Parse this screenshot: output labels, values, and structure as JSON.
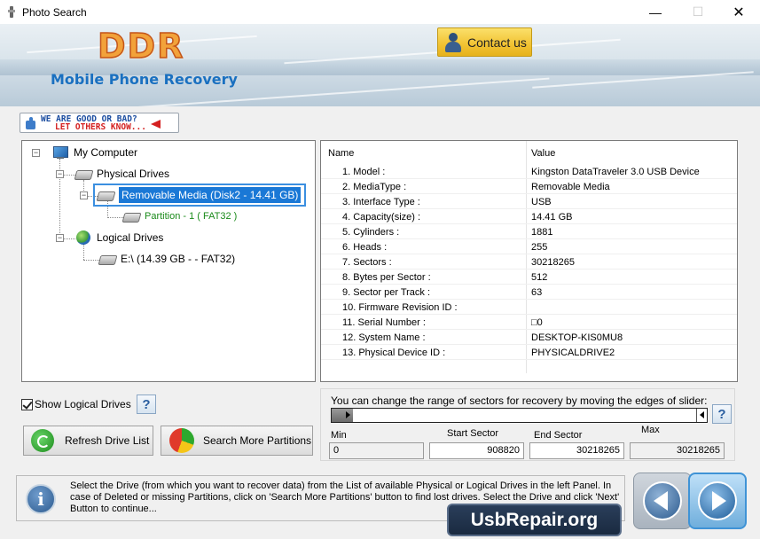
{
  "window": {
    "title": "Photo Search",
    "controls": {
      "minimize": "—",
      "maximize": "☐",
      "close": "✕"
    }
  },
  "header": {
    "logo": "DDR",
    "subtitle": "Mobile Phone Recovery",
    "contact_label": "Contact us"
  },
  "feedback": {
    "line1": "WE ARE GOOD OR BAD?",
    "line2": "LET OTHERS KNOW..."
  },
  "tree": {
    "root": "My Computer",
    "physical": "Physical Drives",
    "removable": "Removable Media (Disk2 - 14.41 GB)",
    "partition": "Partition - 1 ( FAT32 )",
    "logical": "Logical Drives",
    "logical_drive": "E:\\ (14.39 GB -  - FAT32)"
  },
  "show_logical": {
    "label": "Show Logical Drives",
    "checked": true
  },
  "buttons": {
    "refresh": "Refresh Drive List",
    "search_more": "Search More Partitions",
    "help": "?"
  },
  "grid": {
    "headers": {
      "name": "Name",
      "value": "Value"
    },
    "rows": [
      {
        "name": "1. Model :",
        "value": "Kingston DataTraveler 3.0 USB Device"
      },
      {
        "name": "2. MediaType :",
        "value": "Removable Media"
      },
      {
        "name": "3. Interface Type :",
        "value": "USB"
      },
      {
        "name": "4. Capacity(size) :",
        "value": "14.41 GB"
      },
      {
        "name": "5. Cylinders :",
        "value": "1881"
      },
      {
        "name": "6. Heads :",
        "value": "255"
      },
      {
        "name": "7. Sectors :",
        "value": "30218265"
      },
      {
        "name": "8. Bytes per Sector :",
        "value": "512"
      },
      {
        "name": "9. Sector per Track :",
        "value": "63"
      },
      {
        "name": "10. Firmware Revision ID :",
        "value": ""
      },
      {
        "name": "11. Serial Number :",
        "value": "□0"
      },
      {
        "name": "12. System Name :",
        "value": "DESKTOP-KIS0MU8"
      },
      {
        "name": "13. Physical Device ID :",
        "value": "PHYSICALDRIVE2"
      }
    ]
  },
  "slider": {
    "caption": "You can change the range of sectors for recovery by moving the edges of slider:",
    "min_label": "Min",
    "start_label": "Start Sector",
    "end_label": "End Sector",
    "max_label": "Max",
    "min_value": "0",
    "start_value": "908820",
    "end_value": "30218265",
    "max_value": "30218265"
  },
  "info": {
    "text": "Select the Drive (from which you want to recover data) from the List of available Physical or Logical Drives in the left Panel. In case of Deleted or missing Partitions, click on 'Search More Partitions' button to find lost drives. Select the Drive and click 'Next' Button to continue..."
  },
  "watermark": "UsbRepair.org",
  "colors": {
    "accent": "#1a78d6",
    "logo": "#f2a23a",
    "subtitle": "#1a70c0"
  }
}
